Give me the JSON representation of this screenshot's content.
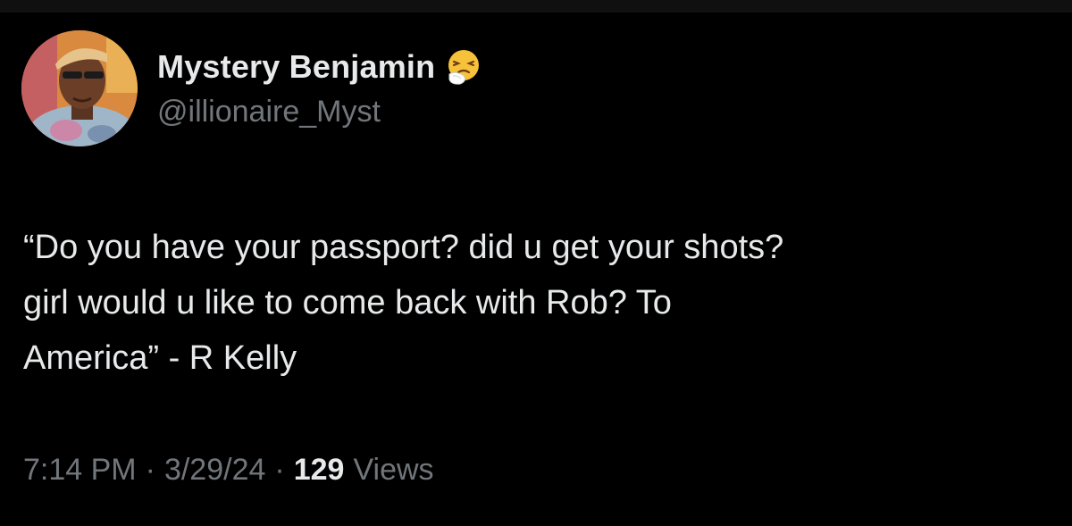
{
  "author": {
    "display_name": "Mystery Benjamin",
    "handle": "@illionaire_Myst",
    "name_emoji_icon": "sneezing-face-icon"
  },
  "tweet": {
    "text": "“Do you have your passport? did u get your shots?\ngirl would u like to come back with Rob? To\nAmerica” - R Kelly",
    "time": "7:14 PM",
    "separator": "·",
    "date": "3/29/24",
    "views_count": "129",
    "views_label": "Views"
  },
  "colors": {
    "background": "#000000",
    "primary_text": "#e7e9ea",
    "secondary_text": "#71767b"
  }
}
